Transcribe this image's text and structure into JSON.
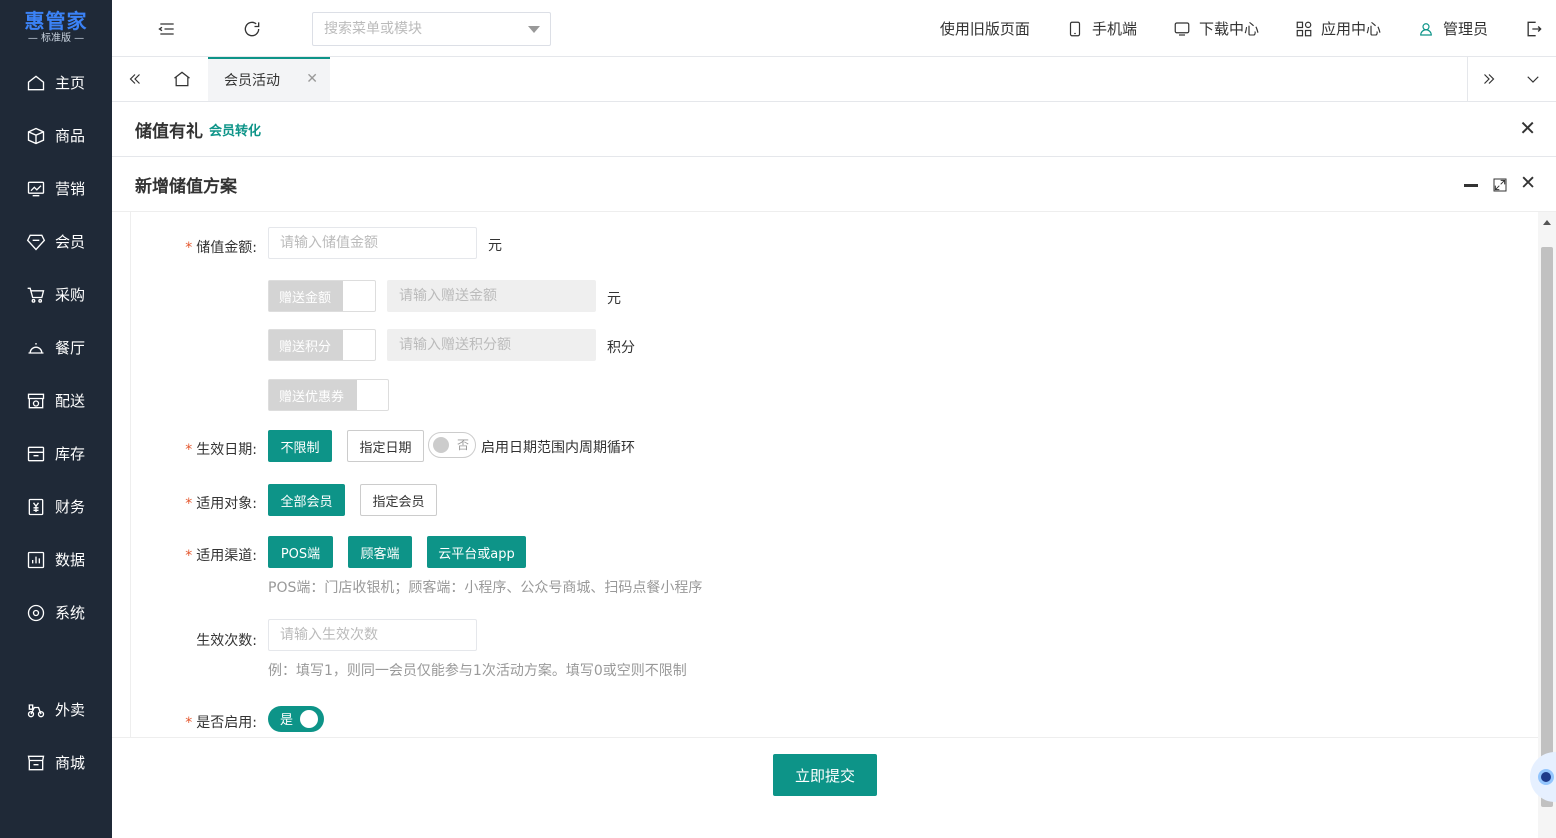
{
  "logo": {
    "title": "惠管家",
    "subtitle": "标准版"
  },
  "sidebar": {
    "items": [
      {
        "label": "主页",
        "icon": "home-icon"
      },
      {
        "label": "商品",
        "icon": "box-icon"
      },
      {
        "label": "营销",
        "icon": "chart-icon"
      },
      {
        "label": "会员",
        "icon": "diamond-icon"
      },
      {
        "label": "采购",
        "icon": "cart-icon"
      },
      {
        "label": "餐厅",
        "icon": "cloche-icon"
      },
      {
        "label": "配送",
        "icon": "store-icon"
      },
      {
        "label": "库存",
        "icon": "archive-icon"
      },
      {
        "label": "财务",
        "icon": "yen-icon"
      },
      {
        "label": "数据",
        "icon": "bars-icon"
      },
      {
        "label": "系统",
        "icon": "settings-icon"
      }
    ],
    "bottom": [
      {
        "label": "外卖",
        "icon": "bike-icon"
      },
      {
        "label": "商城",
        "icon": "shop-icon"
      }
    ]
  },
  "topbar": {
    "search_placeholder": "搜索菜单或模块",
    "old_page": "使用旧版页面",
    "mobile": "手机端",
    "download": "下载中心",
    "apps": "应用中心",
    "user": "管理员"
  },
  "tabs": [
    {
      "label": "会员活动"
    }
  ],
  "panel": {
    "title": "储值有礼",
    "subtitle": "会员转化"
  },
  "dialog": {
    "title": "新增储值方案"
  },
  "form": {
    "amount": {
      "label": "储值金额:",
      "placeholder": "请输入储值金额",
      "unit": "元"
    },
    "gift_amount": {
      "label": "赠送金额",
      "placeholder": "请输入赠送金额",
      "unit": "元"
    },
    "gift_points": {
      "label": "赠送积分",
      "placeholder": "请输入赠送积分额",
      "unit": "积分"
    },
    "gift_coupon": {
      "label": "赠送优惠券"
    },
    "date": {
      "label": "生效日期:",
      "opt1": "不限制",
      "opt2": "指定日期",
      "switch": "否",
      "cycle": "启用日期范围内周期循环"
    },
    "target": {
      "label": "适用对象:",
      "opt1": "全部会员",
      "opt2": "指定会员"
    },
    "channel": {
      "label": "适用渠道:",
      "opt1": "POS端",
      "opt2": "顾客端",
      "opt3": "云平台或app",
      "hint": "POS端：门店收银机；顾客端：小程序、公众号商城、扫码点餐小程序"
    },
    "times": {
      "label": "生效次数:",
      "placeholder": "请输入生效次数",
      "hint": "例：填写1，则同一会员仅能参与1次活动方案。填写0或空则不限制"
    },
    "enable": {
      "label": "是否启用:",
      "switch": "是"
    },
    "required_mark": "*"
  },
  "footer": {
    "submit": "立即提交"
  }
}
